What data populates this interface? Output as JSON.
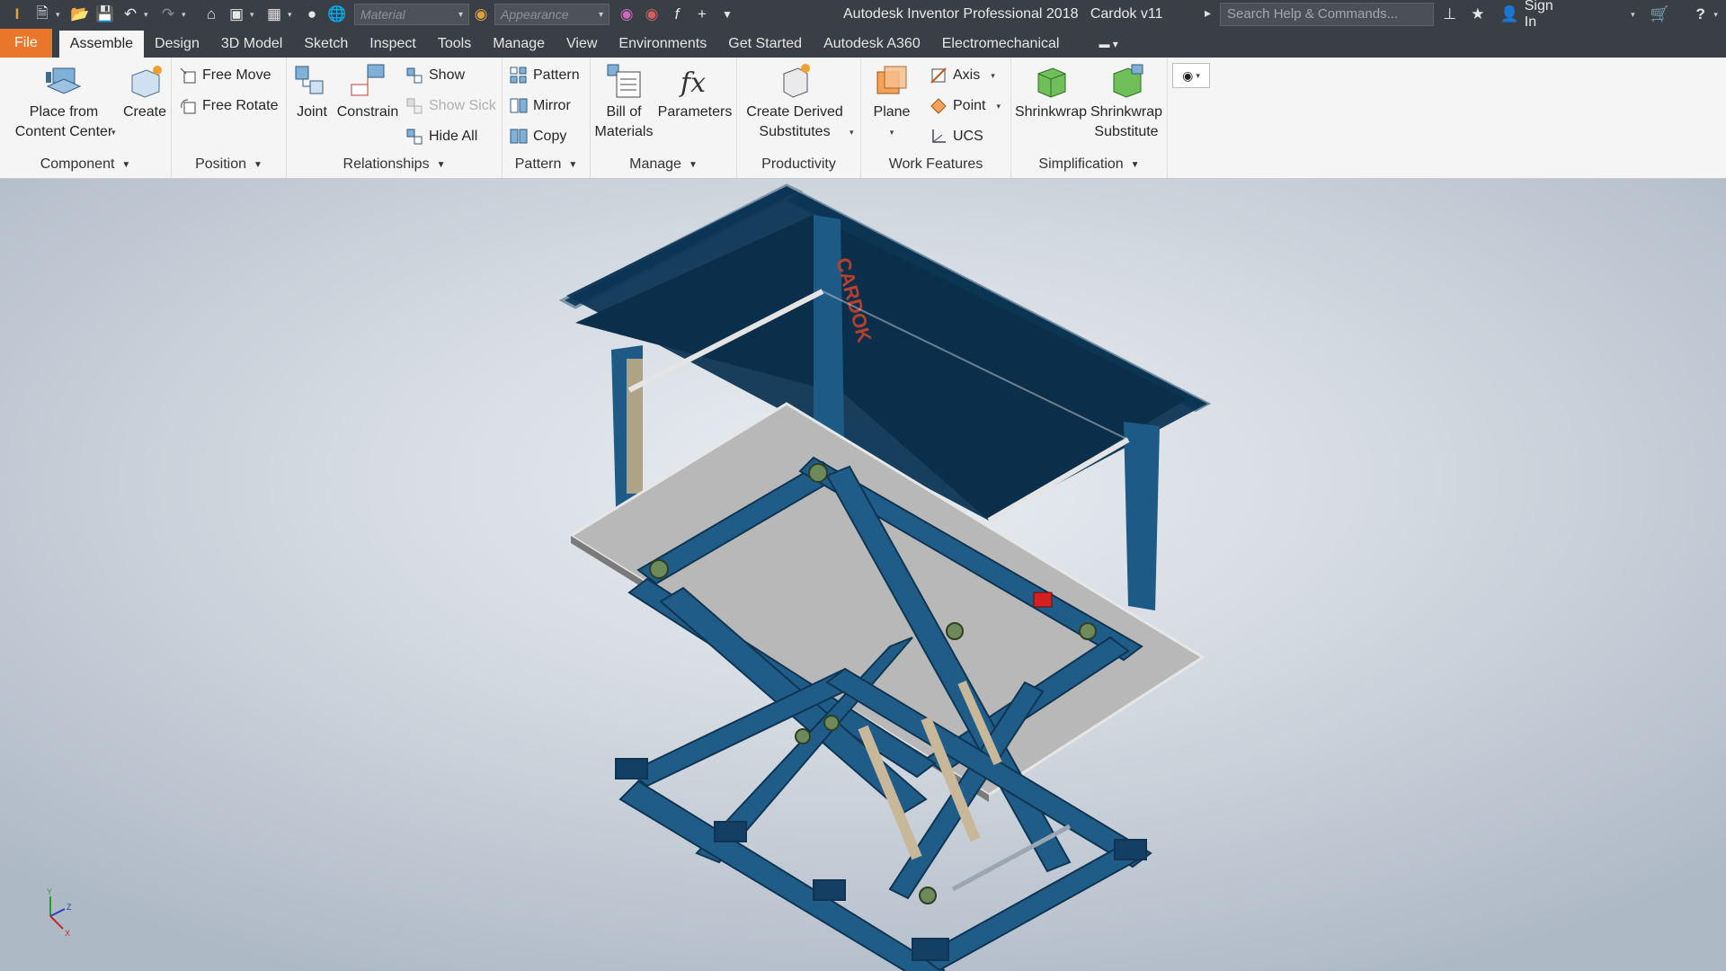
{
  "titlebar": {
    "app_title": "Autodesk Inventor Professional 2018",
    "document_name": "Cardok v11",
    "material_placeholder": "Material",
    "appearance_placeholder": "Appearance",
    "search_placeholder": "Search Help & Commands...",
    "sign_in": "Sign In"
  },
  "tabs": [
    "File",
    "Assemble",
    "Design",
    "3D Model",
    "Sketch",
    "Inspect",
    "Tools",
    "Manage",
    "View",
    "Environments",
    "Get Started",
    "Autodesk A360",
    "Electromechanical"
  ],
  "ribbon": {
    "component": {
      "label": "Component",
      "place_from_content_center": [
        "Place from",
        "Content Center"
      ],
      "create": "Create"
    },
    "position": {
      "label": "Position",
      "free_move": "Free Move",
      "free_rotate": "Free Rotate"
    },
    "relationships": {
      "label": "Relationships",
      "joint": "Joint",
      "constrain": "Constrain",
      "show": "Show",
      "show_sick": "Show Sick",
      "hide_all": "Hide All"
    },
    "pattern": {
      "label": "Pattern",
      "pattern": "Pattern",
      "mirror": "Mirror",
      "copy": "Copy"
    },
    "manage": {
      "label": "Manage",
      "bill_of_materials": [
        "Bill of",
        "Materials"
      ],
      "parameters": "Parameters"
    },
    "productivity": {
      "label": "Productivity",
      "create_derived_substitutes": [
        "Create Derived",
        "Substitutes"
      ]
    },
    "work_features": {
      "label": "Work Features",
      "plane": "Plane",
      "axis": "Axis",
      "point": "Point",
      "ucs": "UCS"
    },
    "simplification": {
      "label": "Simplification",
      "shrinkwrap": "Shrinkwrap",
      "shrinkwrap_substitute": [
        "Shrinkwrap",
        "Substitute"
      ]
    }
  },
  "viewport": {
    "model_text": "CARDOK",
    "triad": {
      "x": "X",
      "y": "Y",
      "z": "Z"
    }
  },
  "colors": {
    "accent_file": "#e9762b",
    "dark_chrome": "#3a3e45",
    "frame_blue": "#1e5a82",
    "deck_gray": "#b7b7b7"
  }
}
